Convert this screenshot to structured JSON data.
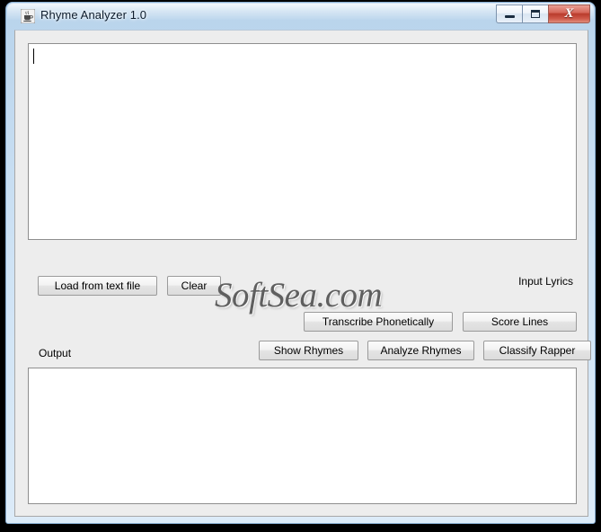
{
  "window": {
    "title": "Rhyme Analyzer 1.0",
    "icon": "java-coffee-cup-icon",
    "controls": {
      "minimize_label": "",
      "maximize_label": "",
      "close_label": "X"
    },
    "colors": {
      "titlebar": "#c3daf0",
      "client_background": "#ededed",
      "textarea_background": "#ffffff",
      "button_face": "#f0f0f0",
      "close_button": "#b93b2c",
      "watermark_text": "#5f5f5f"
    }
  },
  "input_panel": {
    "label": "Input Lyrics",
    "textarea_value": "",
    "textarea_placeholder": "",
    "buttons": [
      {
        "id": "load-from-text-file",
        "label": "Load from text file"
      },
      {
        "id": "clear",
        "label": "Clear"
      }
    ]
  },
  "action_rows": {
    "row_one": [
      {
        "id": "transcribe-phonetically",
        "label": "Transcribe Phonetically"
      },
      {
        "id": "score-lines",
        "label": "Score Lines"
      }
    ],
    "row_two": [
      {
        "id": "show-rhymes",
        "label": "Show Rhymes"
      },
      {
        "id": "analyze-rhymes",
        "label": "Analyze Rhymes"
      },
      {
        "id": "classify-rapper",
        "label": "Classify Rapper"
      }
    ]
  },
  "output_panel": {
    "label": "Output",
    "textarea_value": ""
  },
  "watermark": {
    "text": "SoftSea.com"
  }
}
